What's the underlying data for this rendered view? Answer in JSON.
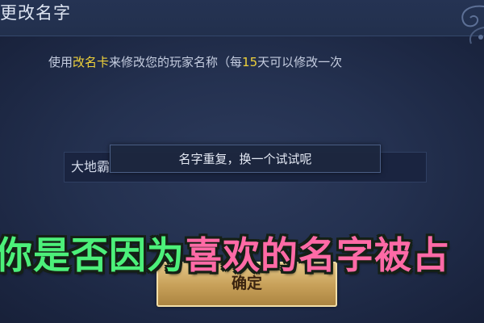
{
  "dialog": {
    "title": "更改名字",
    "desc_prefix": "使用",
    "card_name": "改名卡",
    "desc_mid": "来修改您的玩家名称（每",
    "days": "15",
    "desc_suffix": "天可以修改一次"
  },
  "name_input": {
    "value": "大地霸"
  },
  "toast": {
    "message": "名字重复，换一个试试呢"
  },
  "confirm_button": {
    "label": "确定"
  },
  "caption": {
    "part1": "你是否因为",
    "part2": "喜欢的名字被占"
  },
  "colors": {
    "highlight": "#f0d23a",
    "caption_green": "#4cf07a",
    "caption_pink": "#ff6aa6",
    "button_gold": "#c9a25b"
  }
}
